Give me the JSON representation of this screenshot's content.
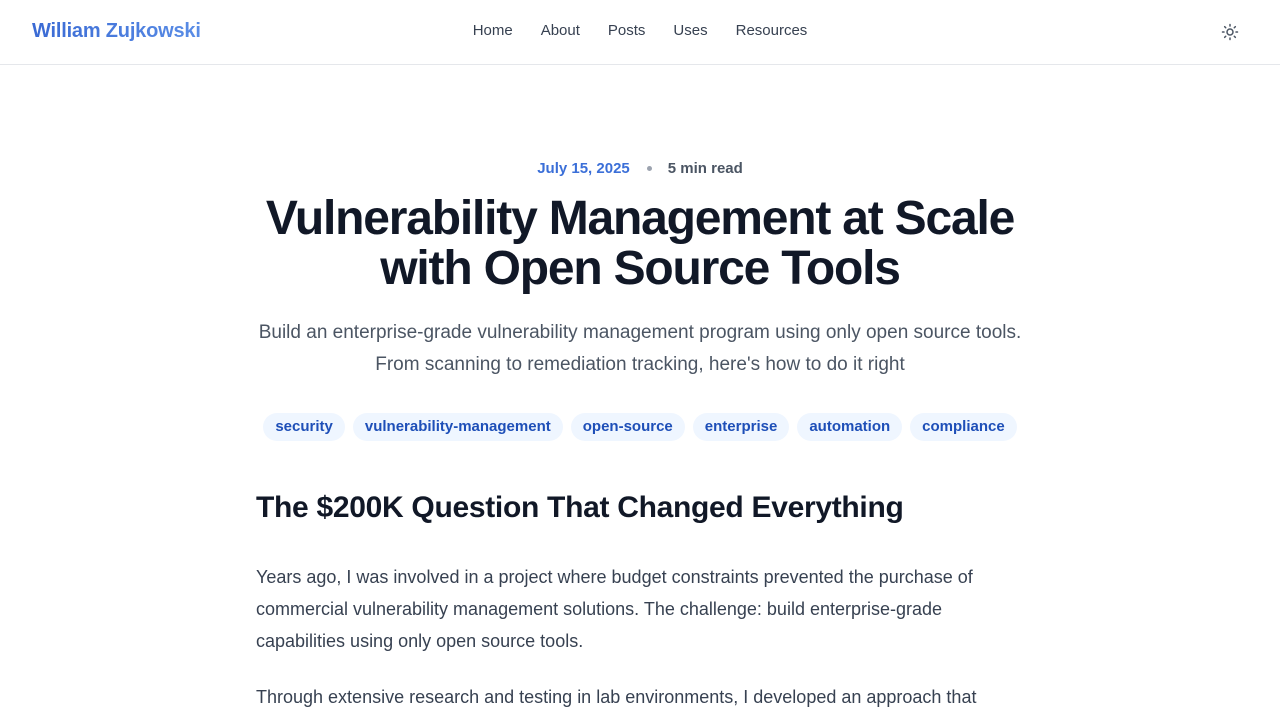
{
  "header": {
    "brand": "William Zujkowski",
    "nav": [
      "Home",
      "About",
      "Posts",
      "Uses",
      "Resources"
    ],
    "theme_toggle_icon": "sun-icon"
  },
  "post": {
    "date": "July 15, 2025",
    "read_time": "5 min read",
    "title": "Vulnerability Management at Scale with Open Source Tools",
    "description": "Build an enterprise-grade vulnerability management program using only open source tools. From scanning to remediation tracking, here's how to do it right",
    "tags": [
      "security",
      "vulnerability-management",
      "open-source",
      "enterprise",
      "automation",
      "compliance"
    ],
    "section_heading": "The $200K Question That Changed Everything",
    "paragraphs": [
      "Years ago, I was involved in a project where budget constraints prevented the purchase of commercial vulnerability management solutions. The challenge: build enterprise-grade capabilities using only open source tools.",
      "Through extensive research and testing in lab environments, I developed an approach that"
    ]
  },
  "colors": {
    "accent": "#3b6fd8",
    "tag_bg": "#eff6ff",
    "tag_text": "#1e4fb8",
    "heading": "#111827",
    "body_text": "#374151"
  }
}
